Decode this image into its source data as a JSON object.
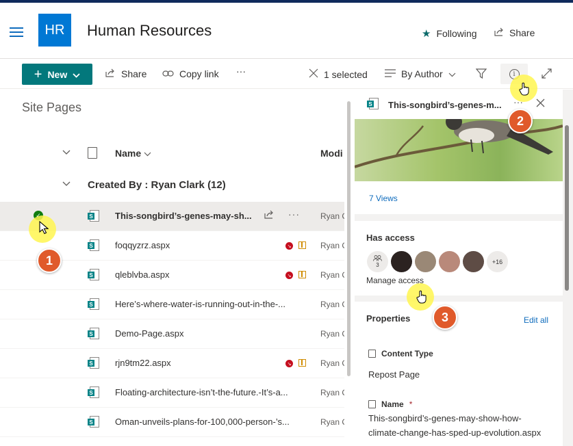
{
  "header": {
    "logo_text": "HR",
    "site_title": "Human Resources",
    "following_label": "Following",
    "share_label": "Share"
  },
  "toolbar": {
    "new_label": "New",
    "share_label": "Share",
    "copy_link_label": "Copy link",
    "more_label": "···",
    "selected_label": "1 selected",
    "view_label": "By Author"
  },
  "list": {
    "title": "Site Pages",
    "col_name": "Name",
    "col_modified": "Modi",
    "group_label": "Created By : Ryan Clark (12)",
    "rows": [
      {
        "name": "This-songbird’s-genes-may-sh...",
        "modified_by": "Ryan C",
        "selected": true
      },
      {
        "name": "foqqyzrz.aspx",
        "modified_by": "Ryan C",
        "alert": true
      },
      {
        "name": "qleblvba.aspx",
        "modified_by": "Ryan C",
        "alert": true
      },
      {
        "name": "Here’s-where-water-is-running-out-in-the-...",
        "modified_by": "Ryan C"
      },
      {
        "name": "Demo-Page.aspx",
        "modified_by": "Ryan C"
      },
      {
        "name": "rjn9tm22.aspx",
        "modified_by": "Ryan C",
        "alert": true
      },
      {
        "name": "Floating-architecture-isn’t-the-future.-It’s-a...",
        "modified_by": "Ryan C"
      },
      {
        "name": "Oman-unveils-plans-for-100,000-person-’s...",
        "modified_by": "Ryan C"
      }
    ]
  },
  "details": {
    "title": "This-songbird’s-genes-m...",
    "views": "7 Views",
    "access_heading": "Has access",
    "group_count": "3",
    "more_count": "+16",
    "manage_access": "Manage access",
    "properties_heading": "Properties",
    "edit_all": "Edit all",
    "content_type_label": "Content Type",
    "content_type_value": "Repost Page",
    "name_label": "Name",
    "name_required": "*",
    "name_value": "This-songbird’s-genes-may-show-how-climate-change-has-sped-up-evolution.aspx"
  },
  "annotations": {
    "step1": "1",
    "step2": "2",
    "step3": "3"
  },
  "colors": {
    "accent": "#03787c",
    "logo_bg": "#0078d4",
    "badge": "#e05a2b",
    "highlight": "#fff650",
    "link": "#0f6cbd"
  }
}
